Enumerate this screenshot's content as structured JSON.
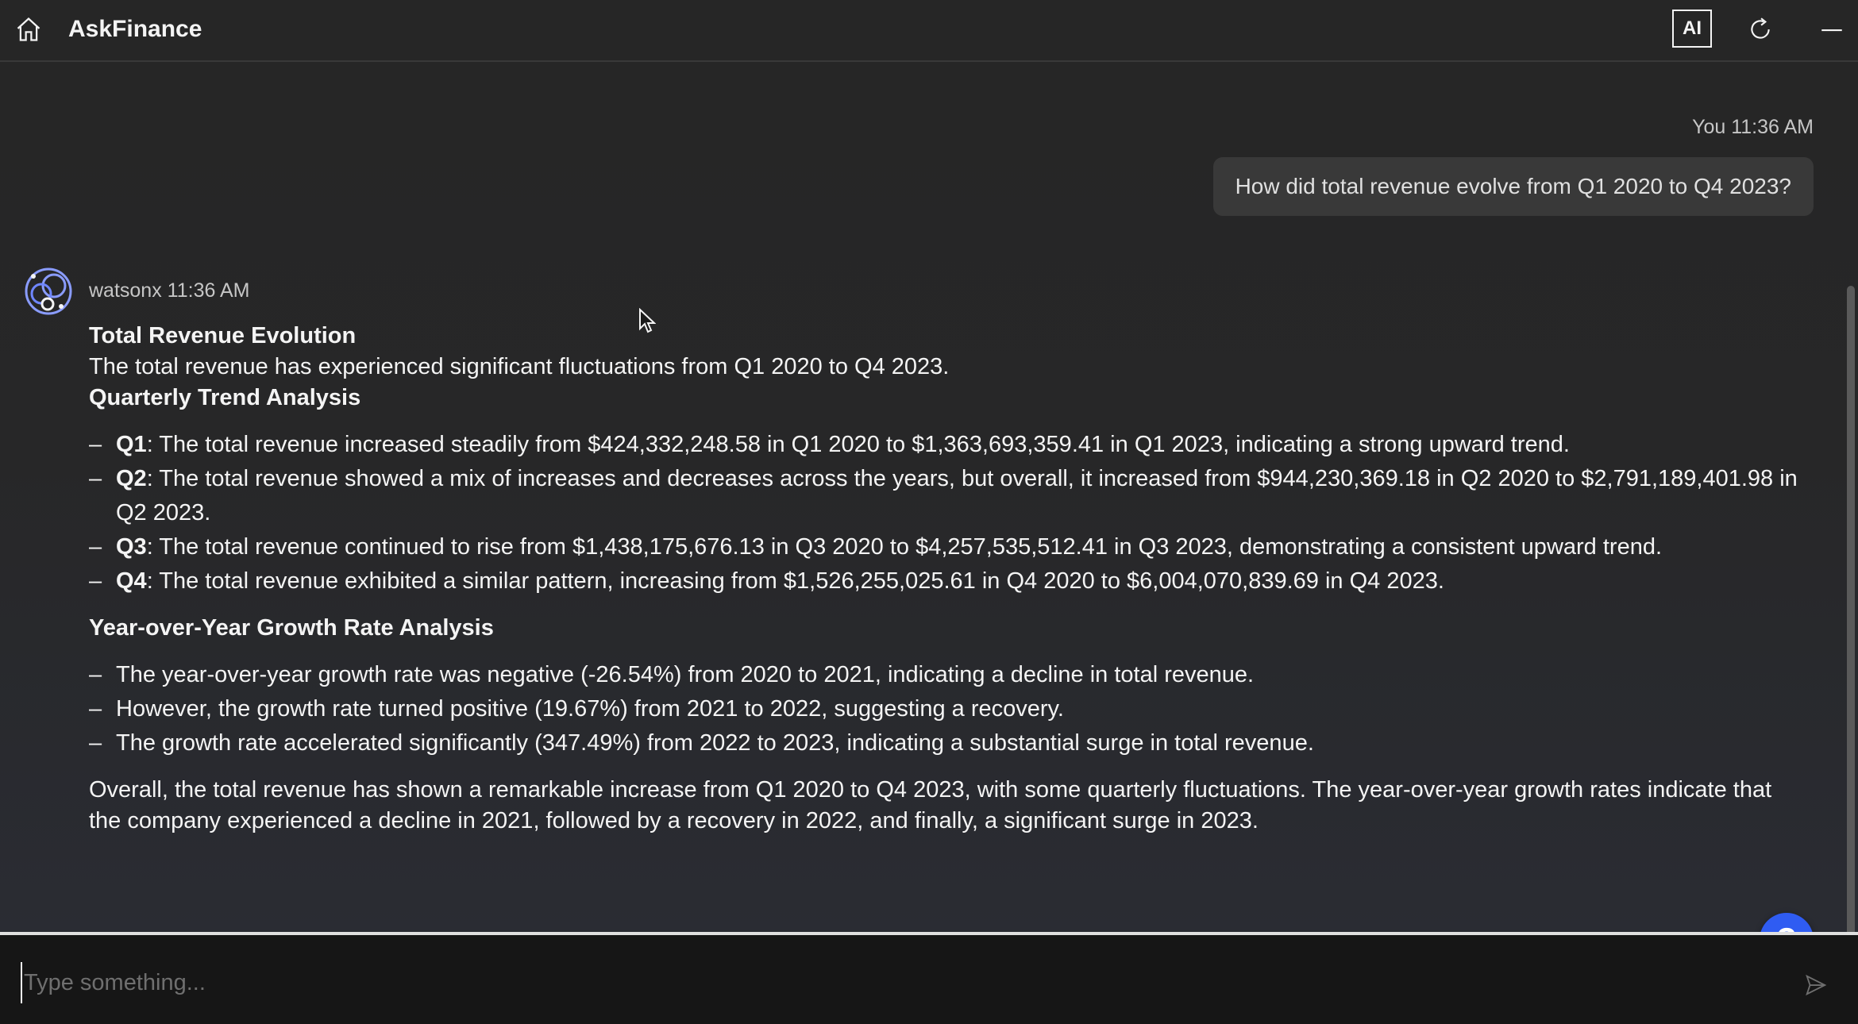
{
  "header": {
    "title": "AskFinance",
    "ai_badge": "AI",
    "icons": [
      "home-icon",
      "refresh-icon",
      "minimize-icon"
    ]
  },
  "user_message": {
    "sender": "You",
    "time": "11:36 AM",
    "text": "How did total revenue evolve from Q1 2020 to Q4 2023?"
  },
  "bot_message": {
    "sender": "watsonx",
    "time": "11:36 AM",
    "heading": "Total Revenue Evolution",
    "intro": "The total revenue has experienced significant fluctuations from Q1 2020 to Q4 2023.",
    "section1_title": "Quarterly Trend Analysis",
    "quarters": [
      {
        "label": "Q1",
        "text": ": The total revenue increased steadily from $424,332,248.58 in Q1 2020 to $1,363,693,359.41 in Q1 2023, indicating a strong upward trend."
      },
      {
        "label": "Q2",
        "text": ": The total revenue showed a mix of increases and decreases across the years, but overall, it increased from $944,230,369.18 in Q2 2020 to $2,791,189,401.98 in Q2 2023."
      },
      {
        "label": "Q3",
        "text": ": The total revenue continued to rise from $1,438,175,676.13 in Q3 2020 to $4,257,535,512.41 in Q3 2023, demonstrating a consistent upward trend."
      },
      {
        "label": "Q4",
        "text": ": The total revenue exhibited a similar pattern, increasing from $1,526,255,025.61 in Q4 2020 to $6,004,070,839.69 in Q4 2023."
      }
    ],
    "section2_title": "Year-over-Year Growth Rate Analysis",
    "growth_points": [
      "The year-over-year growth rate was negative (-26.54%) from 2020 to 2021, indicating a decline in total revenue.",
      "However, the growth rate turned positive (19.67%) from 2021 to 2022, suggesting a recovery.",
      "The growth rate accelerated significantly (347.49%) from 2022 to 2023, indicating a substantial surge in total revenue."
    ],
    "conclusion": "Overall, the total revenue has shown a remarkable increase from Q1 2020 to Q4 2023, with some quarterly fluctuations. The year-over-year growth rates indicate that the company experienced a decline in 2021, followed by a recovery in 2022, and finally, a significant surge in 2023."
  },
  "help_button": {
    "label": "?"
  },
  "input": {
    "placeholder": "Type something...",
    "value": ""
  },
  "colors": {
    "accent": "#2f5cf2",
    "background": "#262626",
    "bubble": "#393939",
    "avatar": "#8a9cff"
  }
}
